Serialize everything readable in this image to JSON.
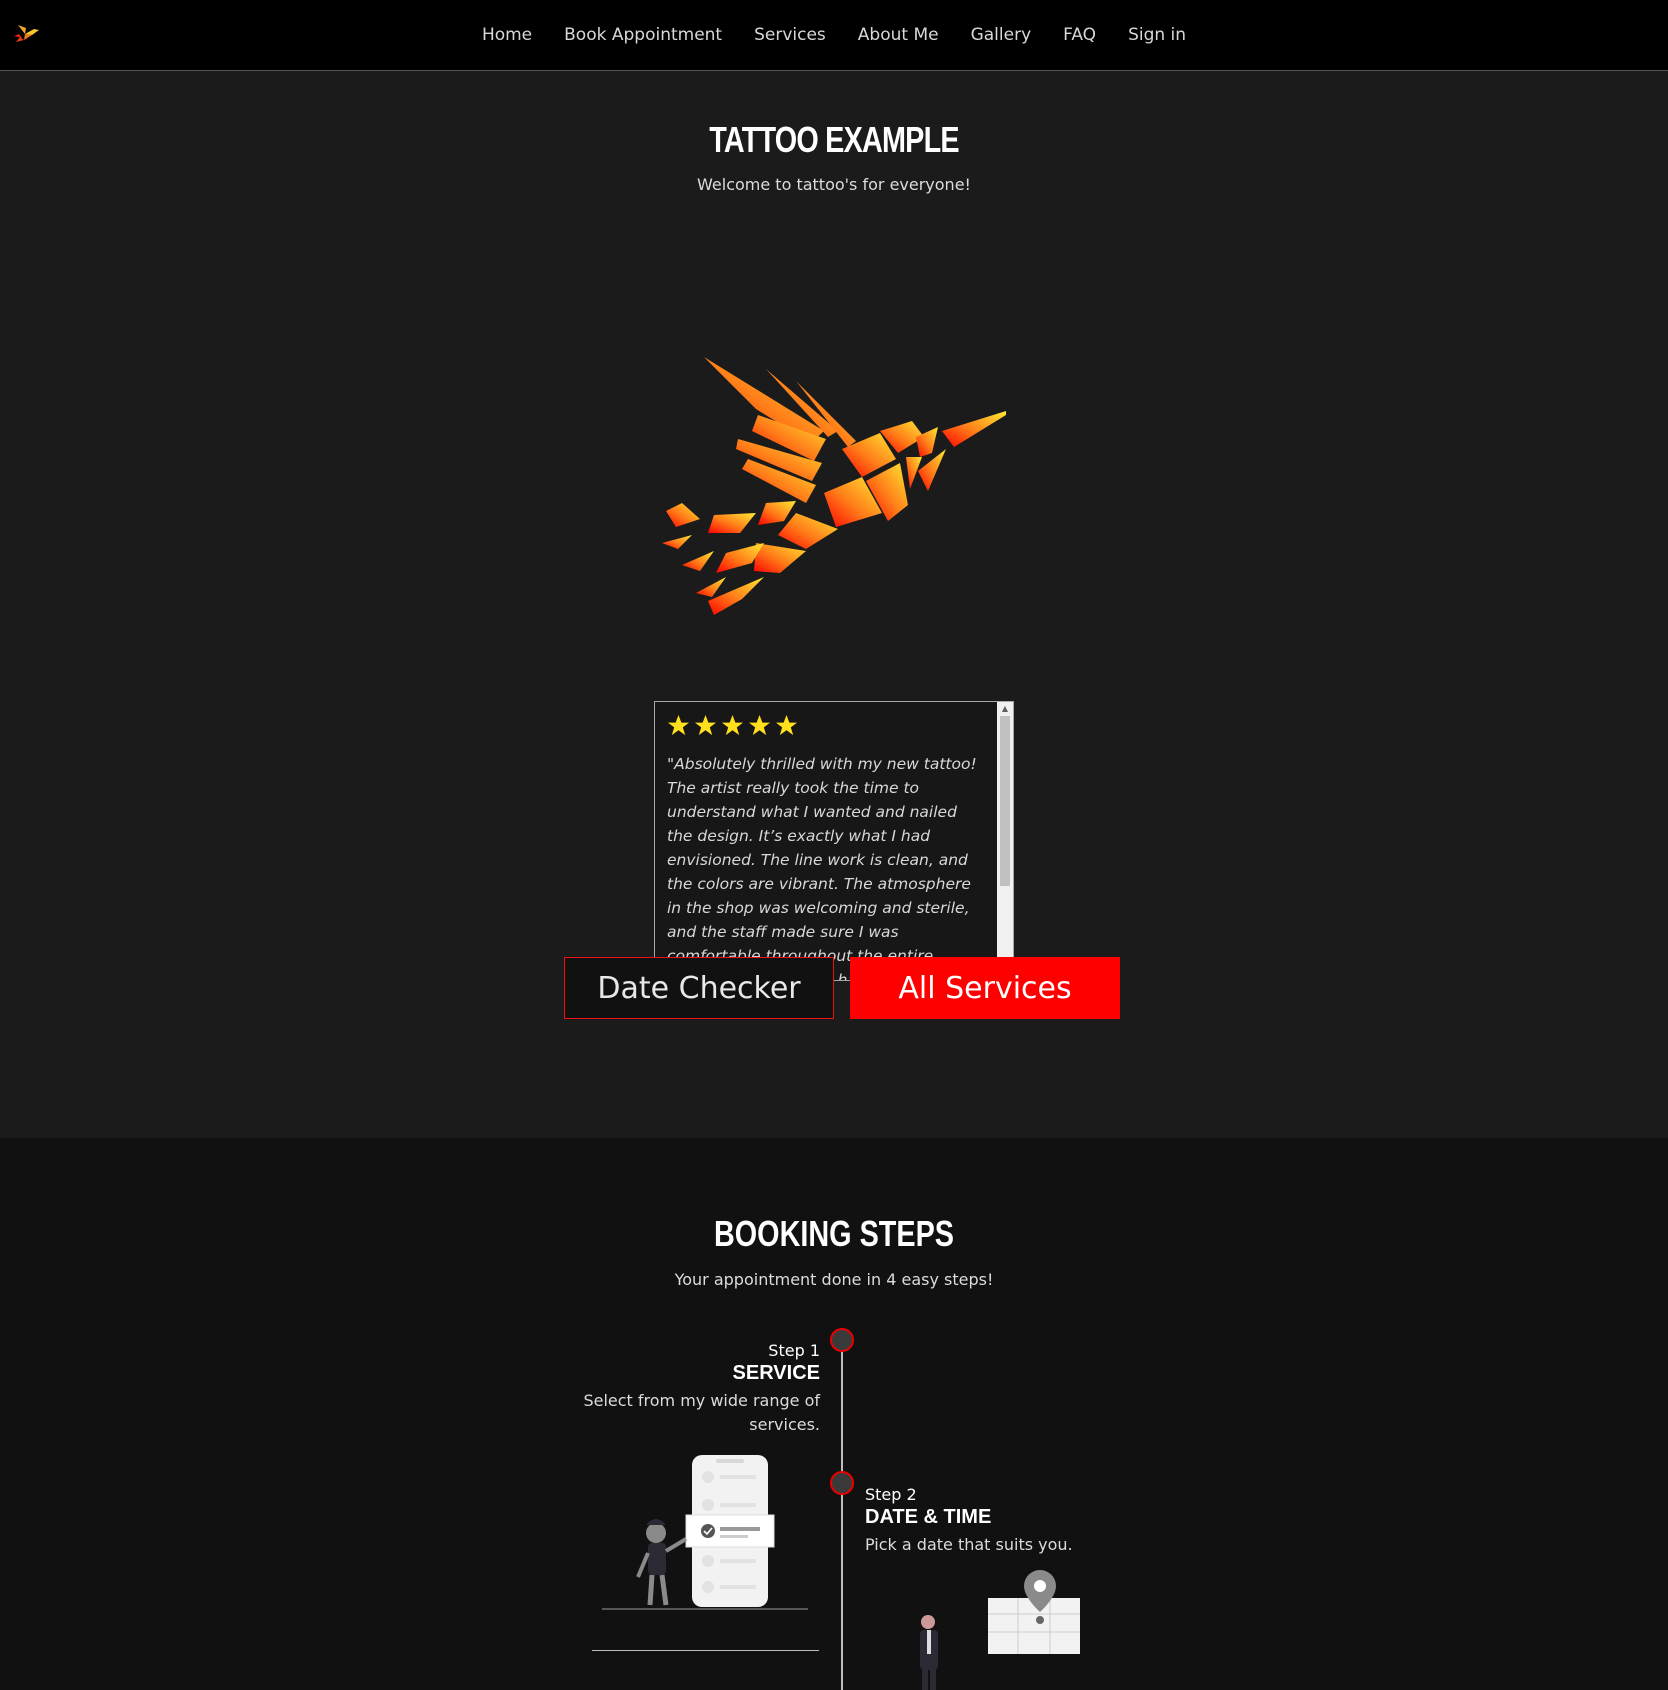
{
  "nav": {
    "items": [
      "Home",
      "Book Appointment",
      "Services",
      "About Me",
      "Gallery",
      "FAQ",
      "Sign in"
    ]
  },
  "hero": {
    "title": "TATTOO EXAMPLE",
    "subtitle": "Welcome to tattoo's for everyone!"
  },
  "review": {
    "stars": 5,
    "text": "\"Absolutely thrilled with my new tattoo! The artist really took the time to understand what I wanted and nailed the design. It’s exactly what I had envisioned. The line work is clean, and the colors are vibrant. The atmosphere in the shop was welcoming and sterile, and the staff made sure I was comfortable throughout the entire process. I couldn't be happier with the"
  },
  "buttons": {
    "date_checker": "Date Checker",
    "all_services": "All Services"
  },
  "booking": {
    "title": "BOOKING STEPS",
    "subtitle": "Your appointment done in 4 easy steps!",
    "steps": [
      {
        "number": "Step 1",
        "heading": "SERVICE",
        "description": "Select from my wide range of services."
      },
      {
        "number": "Step 2",
        "heading": "DATE & TIME",
        "description": "Pick a date that suits you."
      }
    ]
  },
  "colors": {
    "accent": "#ff0000",
    "star": "#ffe01b",
    "background": "#1b1b1b",
    "section_dark": "#111111"
  }
}
